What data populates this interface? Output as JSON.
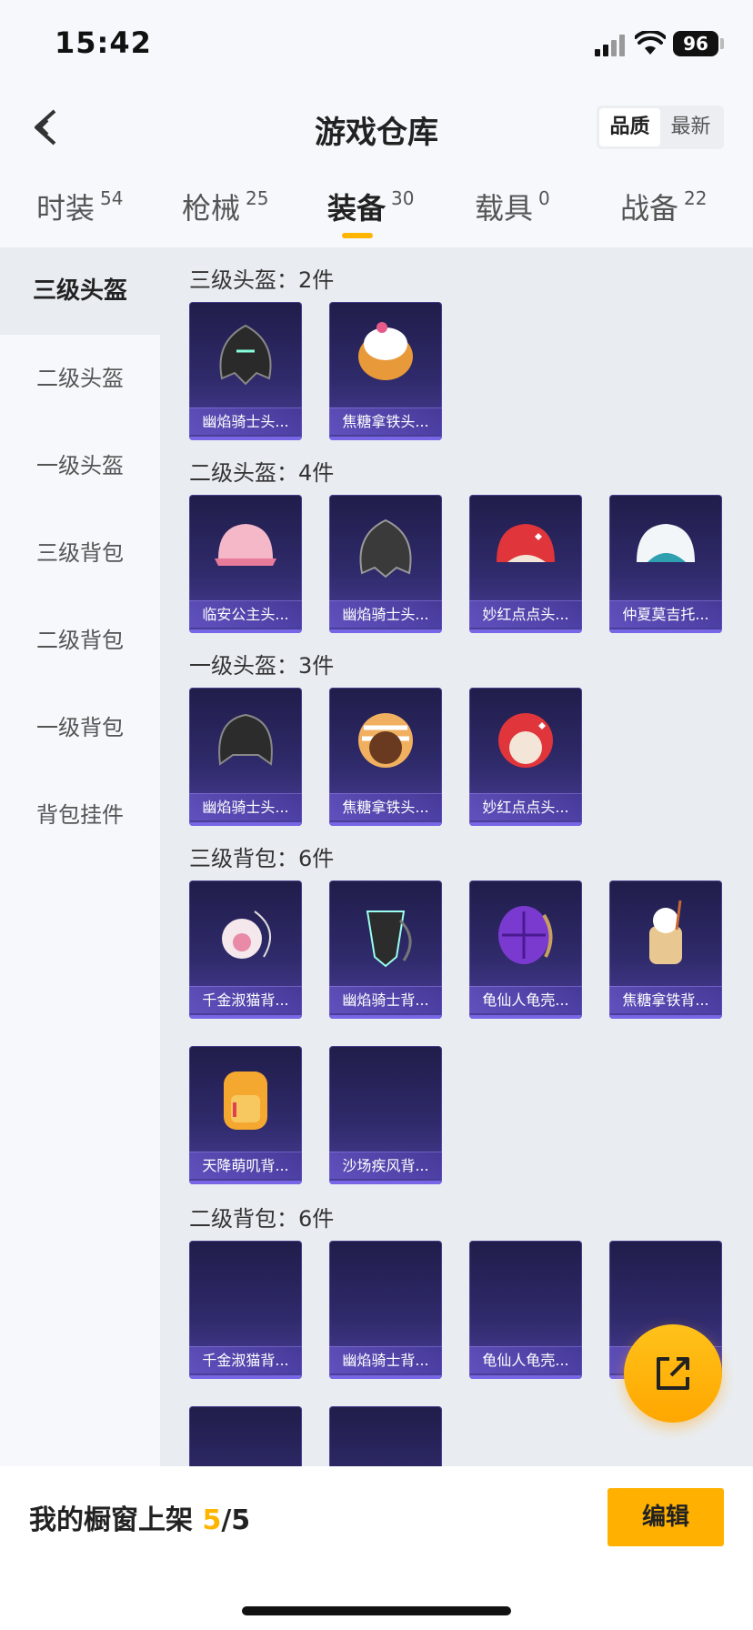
{
  "status": {
    "time": "15:42",
    "battery": "96"
  },
  "header": {
    "title": "游戏仓库",
    "sort_options": [
      "品质",
      "最新"
    ]
  },
  "tabs": [
    {
      "label": "时装",
      "count": "54"
    },
    {
      "label": "枪械",
      "count": "25"
    },
    {
      "label": "装备",
      "count": "30"
    },
    {
      "label": "载具",
      "count": "0"
    },
    {
      "label": "战备",
      "count": "22"
    }
  ],
  "sidebar": {
    "items": [
      "三级头盔",
      "二级头盔",
      "一级头盔",
      "三级背包",
      "二级背包",
      "一级背包",
      "背包挂件"
    ]
  },
  "sections": [
    {
      "title": "三级头盔：2件",
      "items": [
        "幽焰骑士头...",
        "焦糖拿铁头..."
      ]
    },
    {
      "title": "二级头盔：4件",
      "items": [
        "临安公主头...",
        "幽焰骑士头...",
        "妙红点点头...",
        "仲夏莫吉托..."
      ]
    },
    {
      "title": "一级头盔：3件",
      "items": [
        "幽焰骑士头...",
        "焦糖拿铁头...",
        "妙红点点头..."
      ]
    },
    {
      "title": "三级背包：6件",
      "items": [
        "千金淑猫背...",
        "幽焰骑士背...",
        "龟仙人龟壳...",
        "焦糖拿铁背...",
        "天降萌叽背...",
        "沙场疾风背..."
      ]
    },
    {
      "title": "二级背包：6件",
      "items": [
        "千金淑猫背...",
        "幽焰骑士背...",
        "龟仙人龟壳...",
        "",
        "",
        ""
      ]
    }
  ],
  "footer": {
    "shelf_label": "我的橱窗上架 ",
    "shelf_count": "5",
    "shelf_total": "/5",
    "edit_label": "编辑"
  },
  "colors": {
    "accent": "#ffb400",
    "card_bg": "#2f2a6a"
  }
}
